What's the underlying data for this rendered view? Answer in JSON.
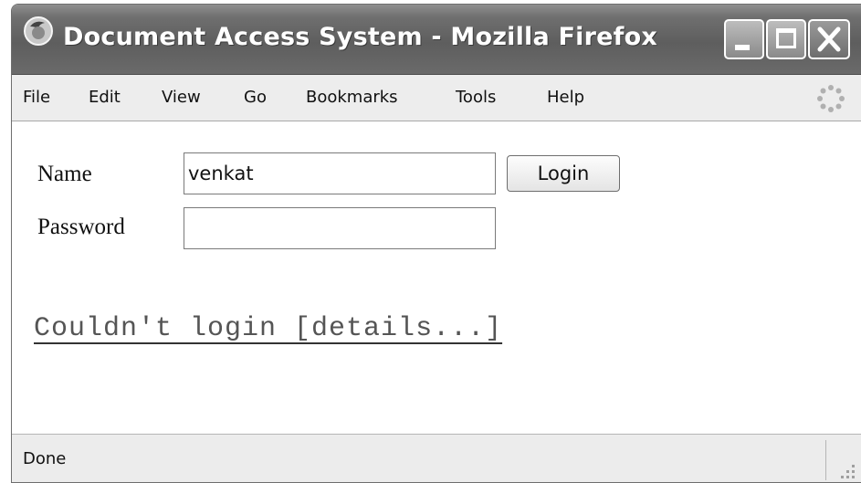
{
  "window": {
    "title": "Document Access System - Mozilla Firefox",
    "buttons": [
      "minimize",
      "maximize",
      "close"
    ]
  },
  "menu": {
    "items": [
      "File",
      "Edit",
      "View",
      "Go",
      "Bookmarks",
      "Tools",
      "Help"
    ]
  },
  "form": {
    "name_label": "Name",
    "name_value": "venkat",
    "password_label": "Password",
    "password_value": "",
    "login_label": "Login"
  },
  "message": {
    "error_link": "Couldn't login [details...]"
  },
  "status": {
    "text": "Done"
  },
  "icons": {
    "app": "firefox-icon",
    "throbber": "throbber-icon",
    "grip": "resize-grip-icon"
  }
}
